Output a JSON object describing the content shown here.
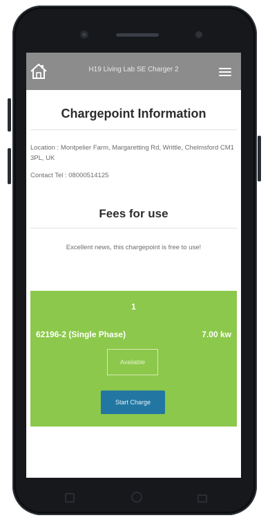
{
  "header": {
    "title": "H19 Living Lab SE Charger 2",
    "home_icon": "home-icon",
    "menu_icon": "hamburger-menu-icon"
  },
  "chargepoint": {
    "heading": "Chargepoint Information",
    "location": "Location : Montpelier Farm, Margaretting Rd, Writtle, Chelmsford CM1 3PL, UK",
    "contact": "Contact Tel : 08000514125"
  },
  "fees": {
    "heading": "Fees for use",
    "note": "Excellent news, this chargepoint is free to use!"
  },
  "connector": {
    "number": "1",
    "name": "62196-2 (Single Phase)",
    "power": "7.00 kw",
    "status": "Available",
    "start_label": "Start Charge"
  },
  "colors": {
    "topbar": "#8c8c8c",
    "card": "#8cc84b",
    "button": "#2277a2"
  }
}
